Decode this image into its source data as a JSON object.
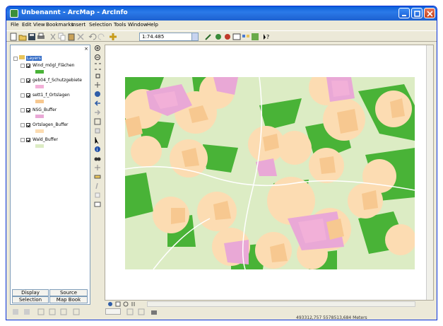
{
  "window": {
    "title": "Unbenannt - ArcMap - ArcInfo"
  },
  "menu": [
    "File",
    "Edit",
    "View",
    "Bookmarks",
    "Insert",
    "Selection",
    "Tools",
    "Window",
    "Help"
  ],
  "toolbar": {
    "scale": "1:74.485"
  },
  "toc": {
    "root_label": "Layers",
    "layers": [
      {
        "name": "Wind_mögl_Flächen",
        "color": "#49b337"
      },
      {
        "name": "geb04_f_Schutzgebiete",
        "color": "#f2b0d8"
      },
      {
        "name": "sett1_f_Ortslagen",
        "color": "#f7c890"
      },
      {
        "name": "NSG_Buffer",
        "color": "#e9a8d6"
      },
      {
        "name": "Ortslagen_Buffer",
        "color": "#fcdcb2"
      },
      {
        "name": "Wald_Buffer",
        "color": "#dcecc4"
      }
    ],
    "tabs": {
      "display": "Display",
      "source": "Source",
      "selection": "Selection",
      "mapbook": "Map Book"
    }
  },
  "statusbar": {
    "coordinates": "493312,757  5578513,684 Meters"
  },
  "colors": {
    "green": "#49b337",
    "light_green": "#dcecc4",
    "orange_buffer": "#fcdcb2",
    "settlement": "#f7c890",
    "pink": "#e9a8d6"
  }
}
